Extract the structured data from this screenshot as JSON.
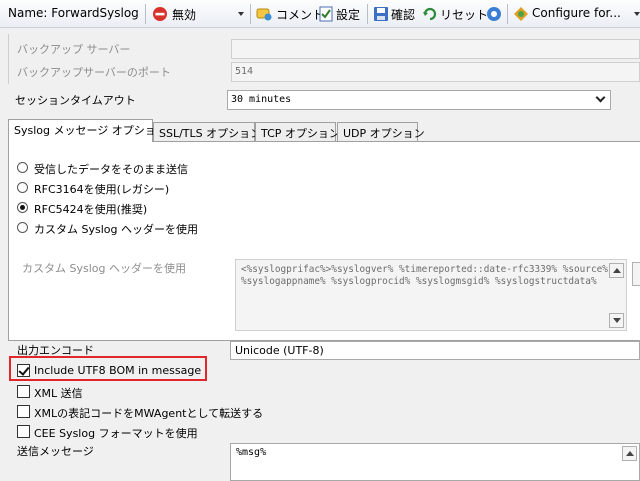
{
  "toolbar": {
    "name_label": "Name: ForwardSyslog",
    "status_label": "無効",
    "comment_label": "コメント",
    "settings_label": "設定",
    "confirm_label": "確認",
    "reset_label": "リセット",
    "configure_label": "Configure for..."
  },
  "colors": {
    "highlight": "#e0282c",
    "disabled_red": "#d9312b"
  },
  "form": {
    "backup_server_label": "バックアップ サーバー",
    "backup_server_value": "",
    "backup_port_label": "バックアップサーバーのポート",
    "backup_port_value": "514",
    "session_timeout_label": "セッションタイムアウト",
    "session_timeout_value": "30 minutes",
    "tabs": [
      {
        "label": "Syslog メッセージ オプション"
      },
      {
        "label": "SSL/TLS オプション"
      },
      {
        "label": "TCP オプション"
      },
      {
        "label": "UDP オプション"
      }
    ],
    "radios": [
      {
        "label": "受信したデータをそのまま送信"
      },
      {
        "label": "RFC3164を使用(レガシー)"
      },
      {
        "label": "RFC5424を使用(推奨)"
      },
      {
        "label": "カスタム Syslog ヘッダーを使用"
      }
    ],
    "custom_header_label": "カスタム Syslog ヘッダーを使用",
    "custom_header_line1": "<%syslogprifac%>%syslogver% %timereported::date-rfc3339% %source%",
    "custom_header_line2": "%syslogappname% %syslogprocid% %syslogmsgid% %syslogstructdata%",
    "output_encoding_label": "出力エンコード",
    "output_encoding_value": "Unicode (UTF-8)",
    "checkboxes": [
      {
        "label": "Include UTF8 BOM in message"
      },
      {
        "label": "XML 送信"
      },
      {
        "label": "XMLの表記コードをMWAgentとして転送する"
      },
      {
        "label": "CEE Syslog フォーマットを使用"
      }
    ],
    "message_label": "送信メッセージ",
    "message_value": "%msg%"
  }
}
